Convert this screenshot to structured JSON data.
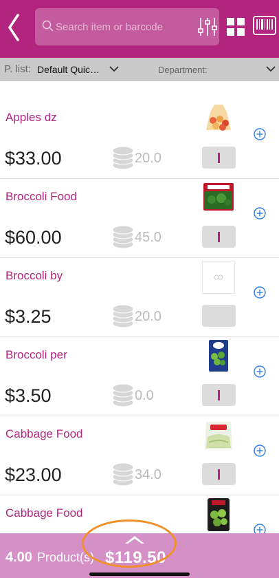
{
  "header": {
    "search_placeholder": "Search item or barcode",
    "icons": [
      "back-icon",
      "search-icon",
      "sliders-icon",
      "grid-icon",
      "barcode-icon"
    ]
  },
  "filters": {
    "price_list_label": "P. list:",
    "price_list_value": "Default Quic…",
    "department_label": "Department:"
  },
  "items": [
    {
      "name": "Apples dz",
      "price": "$33.00",
      "stock": "20.0"
    },
    {
      "name": "Broccoli Food",
      "price": "$60.00",
      "stock": "45.0"
    },
    {
      "name": "Broccoli by",
      "price": "$3.25",
      "stock": "20.0"
    },
    {
      "name": "Broccoli per",
      "price": "$3.50",
      "stock": "0.0"
    },
    {
      "name": "Cabbage Food",
      "price": "$23.00",
      "stock": "34.0"
    },
    {
      "name": "Cabbage Food",
      "price": "",
      "stock": ""
    }
  ],
  "footer": {
    "count": "4.00",
    "unit": "Product(s)",
    "total": "$119.50"
  },
  "colors": {
    "brand": "#b2257f",
    "footer": "#d490c7",
    "filterbar": "#c9c9c9",
    "highlight": "#f0902a",
    "add_icon": "#2f7ee8"
  }
}
